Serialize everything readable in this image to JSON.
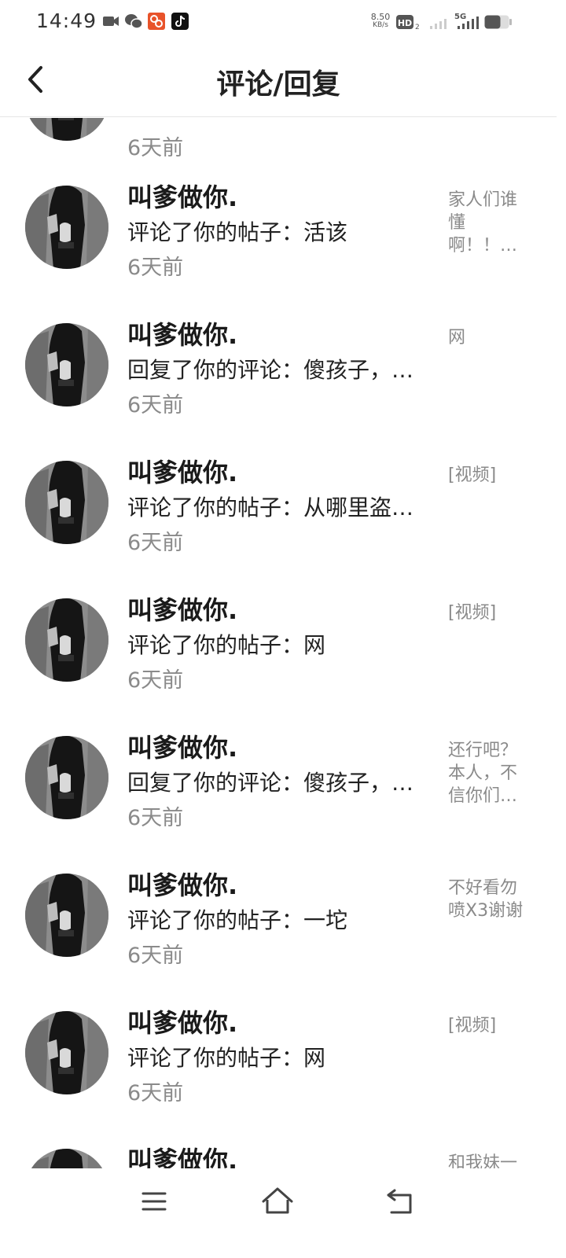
{
  "status_bar": {
    "time": "14:49",
    "net_speed_value": "8.50",
    "net_speed_unit": "KB/s",
    "hd_label": "HD",
    "network_label": "5G",
    "icons": [
      "video-camera-icon",
      "wechat-icon",
      "app-icon",
      "tiktok-icon",
      "hd-icon",
      "signal-icon",
      "5g-signal-icon",
      "battery-icon"
    ]
  },
  "header": {
    "title": "评论/回复",
    "back_icon": "chevron-left-icon"
  },
  "list": {
    "partial_top_time": "6天前",
    "items": [
      {
        "name": "叫爹做你.",
        "action": "评论了你的帖子：活该",
        "time": "6天前",
        "ref": "家人们谁懂啊！！…"
      },
      {
        "name": "叫爹做你.",
        "action": "回复了你的评论：傻孩子，…",
        "time": "6天前",
        "ref": "网"
      },
      {
        "name": "叫爹做你.",
        "action": "评论了你的帖子：从哪里盗…",
        "time": "6天前",
        "ref": "[视频]"
      },
      {
        "name": "叫爹做你.",
        "action": "评论了你的帖子：网",
        "time": "6天前",
        "ref": "[视频]"
      },
      {
        "name": "叫爹做你.",
        "action": "回复了你的评论：傻孩子，…",
        "time": "6天前",
        "ref": "还行吧？本人，不信你们…"
      },
      {
        "name": "叫爹做你.",
        "action": "评论了你的帖子：一坨",
        "time": "6天前",
        "ref": "不好看勿喷X3谢谢"
      },
      {
        "name": "叫爹做你.",
        "action": "评论了你的帖子：网",
        "time": "6天前",
        "ref": "[视频]"
      }
    ],
    "partial_bottom": {
      "name": "叫爹做你.",
      "ref": "和我妹一"
    }
  },
  "nav": {
    "icons": [
      "menu-icon",
      "home-icon",
      "back-icon"
    ]
  }
}
